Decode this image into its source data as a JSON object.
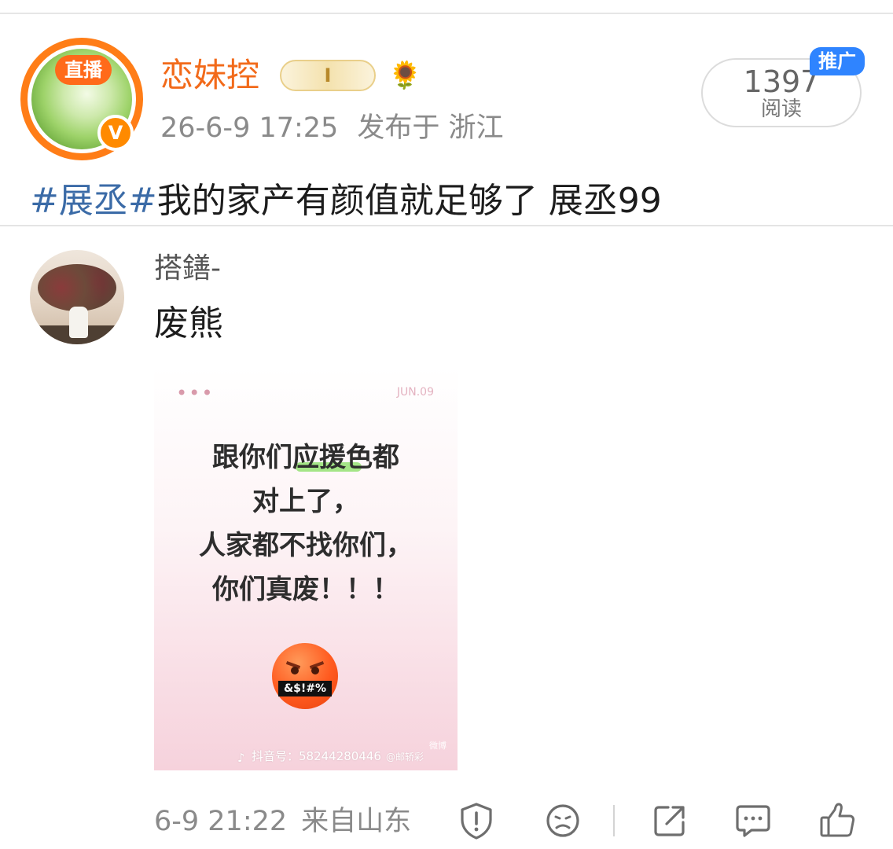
{
  "post": {
    "live_badge": "直播",
    "verified_badge": "V",
    "username": "恋妹控",
    "vip_badge": "I",
    "flower": "🌻",
    "timestamp": "26-6-9 17:25",
    "location": "发布于 浙江",
    "read_count": "1397",
    "read_label": "阅读",
    "promo_tag": "推广",
    "hashtag": "#展丞#",
    "text": "我的家产有颜值就足够了 展丞99"
  },
  "comment": {
    "username": "搭鐥-",
    "text": "废熊",
    "image": {
      "dots": "•••",
      "date": "JUN.09",
      "caption": [
        "跟你们应援色都",
        "对上了，",
        "人家都不找你们，",
        "你们真废！！！"
      ],
      "emoji_text": "&$!#%",
      "watermark": "抖音号：58244280446",
      "watermark_sig": "@邮轿彩",
      "weibo_mark": "微博"
    },
    "timestamp": "6-9 21:22",
    "location": "来自山东"
  },
  "actions": [
    "report-icon",
    "sad-face-icon",
    "share-icon",
    "comment-icon",
    "like-icon"
  ]
}
